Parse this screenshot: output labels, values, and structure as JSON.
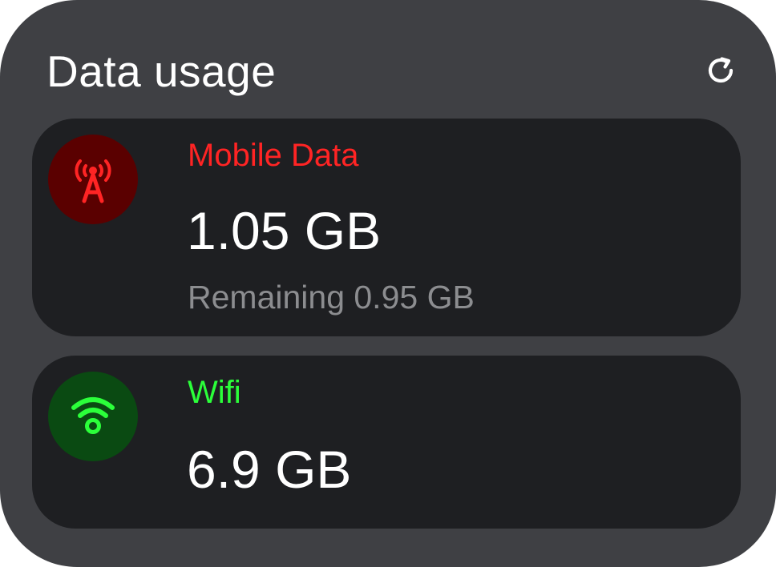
{
  "widget": {
    "title": "Data usage",
    "refresh_icon": "refresh-icon"
  },
  "mobile": {
    "label": "Mobile Data",
    "value": "1.05 GB",
    "remaining": "Remaining 0.95 GB",
    "icon": "cell-tower-icon",
    "accent_color": "#ff2424",
    "icon_bg_color": "#5a0000"
  },
  "wifi": {
    "label": "Wifi",
    "value": "6.9 GB",
    "icon": "wifi-icon",
    "accent_color": "#2bff3a",
    "icon_bg_color": "#0a4a12"
  },
  "colors": {
    "widget_bg": "#3f4044",
    "card_bg": "#1e1f22",
    "secondary_text": "#8c8d90"
  }
}
